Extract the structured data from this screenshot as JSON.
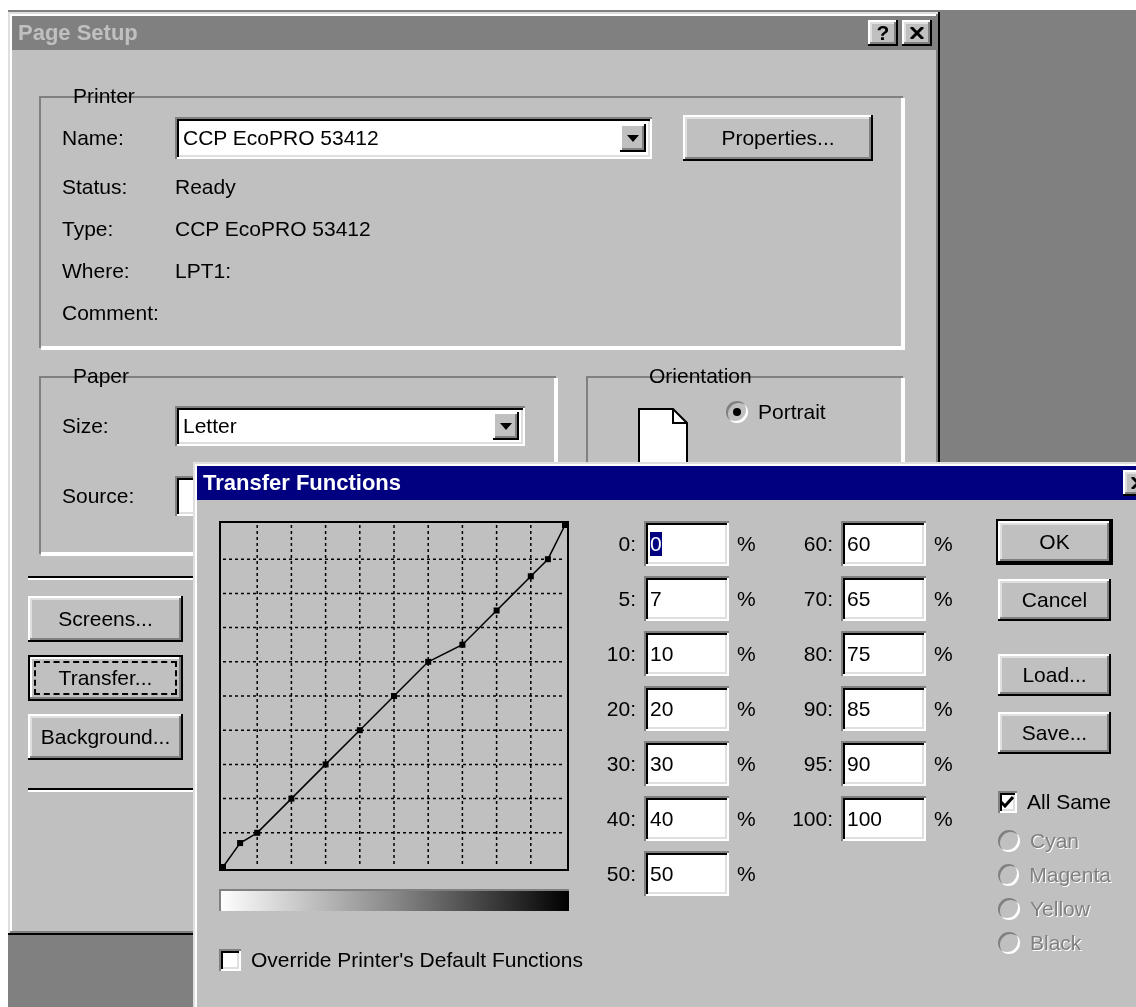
{
  "page_setup": {
    "title": "Page Setup",
    "help_button": "?",
    "printer": {
      "legend": "Printer",
      "name_label": "Name:",
      "name_value": "CCP EcoPRO 53412",
      "properties_button": "Properties...",
      "info": [
        {
          "label": "Status:",
          "value": "Ready"
        },
        {
          "label": "Type:",
          "value": "CCP EcoPRO 53412"
        },
        {
          "label": "Where:",
          "value": "LPT1:"
        },
        {
          "label": "Comment:"
        }
      ]
    },
    "paper": {
      "legend": "Paper",
      "size_label": "Size:",
      "size_value": "Letter",
      "source_label": "Source:"
    },
    "orientation": {
      "legend": "Orientation",
      "options": [
        {
          "label": "Portrait",
          "selected": true
        }
      ]
    },
    "buttons": [
      {
        "label": "Screens...",
        "focused": false
      },
      {
        "label": "Transfer...",
        "focused": true
      },
      {
        "label": "Background...",
        "focused": false
      }
    ]
  },
  "transfer": {
    "title": "Transfer Functions",
    "columns": [
      [
        {
          "label": "0:",
          "value": "0",
          "unit": "%",
          "highlighted": true
        },
        {
          "label": "5:",
          "value": "7",
          "unit": "%",
          "highlighted": false
        },
        {
          "label": "10:",
          "value": "10",
          "unit": "%",
          "highlighted": false
        },
        {
          "label": "20:",
          "value": "20",
          "unit": "%",
          "highlighted": false
        },
        {
          "label": "30:",
          "value": "30",
          "unit": "%",
          "highlighted": false
        },
        {
          "label": "40:",
          "value": "40",
          "unit": "%",
          "highlighted": false
        },
        {
          "label": "50:",
          "value": "50",
          "unit": "%",
          "highlighted": false
        }
      ],
      [
        {
          "label": "60:",
          "value": "60",
          "unit": "%",
          "highlighted": false
        },
        {
          "label": "70:",
          "value": "65",
          "unit": "%",
          "highlighted": false
        },
        {
          "label": "80:",
          "value": "75",
          "unit": "%",
          "highlighted": false
        },
        {
          "label": "90:",
          "value": "85",
          "unit": "%",
          "highlighted": false
        },
        {
          "label": "95:",
          "value": "90",
          "unit": "%",
          "highlighted": false
        },
        {
          "label": "100:",
          "value": "100",
          "unit": "%",
          "highlighted": false
        }
      ]
    ],
    "buttons": [
      {
        "label": "OK",
        "default": true
      },
      {
        "label": "Cancel",
        "default": false
      },
      {
        "label": "Load...",
        "default": false
      },
      {
        "label": "Save...",
        "default": false
      }
    ],
    "all_same": {
      "label": "All Same",
      "checked": true
    },
    "inks": [
      {
        "label": "Cyan",
        "selected": false,
        "disabled": true
      },
      {
        "label": "Magenta",
        "selected": false,
        "disabled": true
      },
      {
        "label": "Yellow",
        "selected": false,
        "disabled": true
      },
      {
        "label": "Black",
        "selected": false,
        "disabled": true
      }
    ],
    "override": {
      "label": "Override Printer's Default Functions",
      "checked": false
    }
  }
}
